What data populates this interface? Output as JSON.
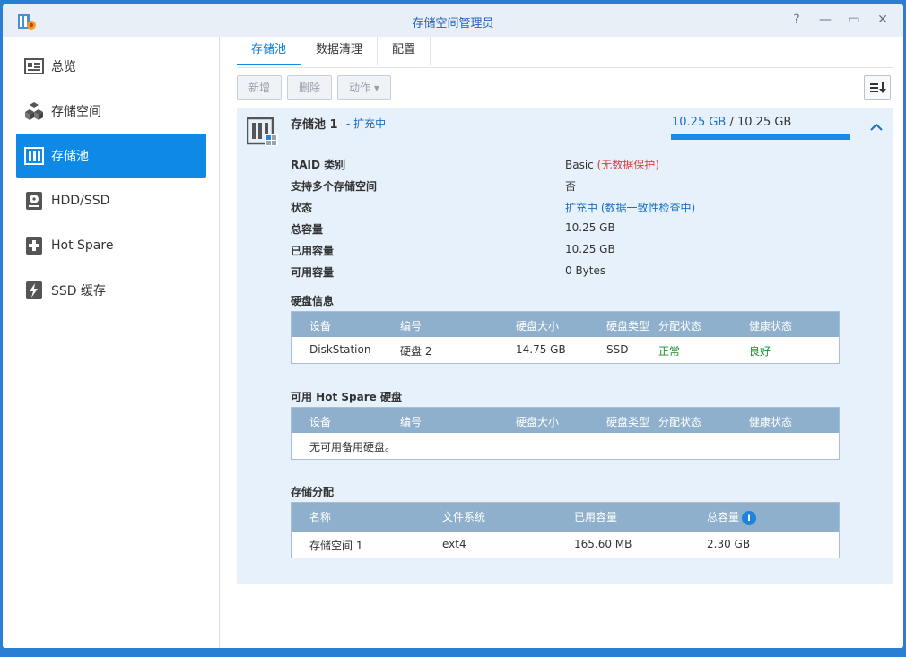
{
  "window": {
    "title": "存储空间管理员"
  },
  "sidebar": {
    "items": [
      {
        "label": "总览"
      },
      {
        "label": "存储空间"
      },
      {
        "label": "存储池"
      },
      {
        "label": "HDD/SSD"
      },
      {
        "label": "Hot Spare"
      },
      {
        "label": "SSD 缓存"
      }
    ]
  },
  "tabs": [
    {
      "label": "存储池"
    },
    {
      "label": "数据清理"
    },
    {
      "label": "配置"
    }
  ],
  "toolbar": {
    "add": "新增",
    "delete": "删除",
    "action": "动作 ▾"
  },
  "pool": {
    "name": "存储池 1",
    "status_suffix": "- 扩充中",
    "capacity_used": "10.25 GB",
    "capacity_sep": " / ",
    "capacity_total": "10.25 GB",
    "usage_percent": 100,
    "details": [
      {
        "label": "RAID 类别",
        "value": "Basic",
        "value_extra": " (无数据保护)"
      },
      {
        "label": "支持多个存储空间",
        "value": "否",
        "value_extra": ""
      },
      {
        "label": "状态",
        "value": "扩充中 (数据一致性检查中)",
        "value_extra": ""
      },
      {
        "label": "总容量",
        "value": "10.25 GB",
        "value_extra": ""
      },
      {
        "label": "已用容量",
        "value": "10.25 GB",
        "value_extra": ""
      },
      {
        "label": "可用容量",
        "value": "0 Bytes",
        "value_extra": ""
      }
    ],
    "disk_info": {
      "title": "硬盘信息",
      "columns": [
        "设备",
        "编号",
        "硬盘大小",
        "硬盘类型",
        "分配状态",
        "健康状态"
      ],
      "rows": [
        [
          "DiskStation",
          "硬盘 2",
          "14.75 GB",
          "SSD",
          "正常",
          "良好"
        ]
      ]
    },
    "hot_spare": {
      "title": "可用 Hot Spare 硬盘",
      "columns": [
        "设备",
        "编号",
        "硬盘大小",
        "硬盘类型",
        "分配状态",
        "健康状态"
      ],
      "empty_text": "无可用备用硬盘。"
    },
    "allocation": {
      "title": "存储分配",
      "columns": [
        "名称",
        "文件系统",
        "已用容量",
        "总容量"
      ],
      "rows": [
        [
          "存储空间 1",
          "ext4",
          "165.60 MB",
          "2.30 GB"
        ]
      ]
    }
  },
  "colors": {
    "accent": "#0e8ae6",
    "table_header": "#8fb0cc",
    "panel_bg": "#e6f1fb",
    "danger": "#e23b3b",
    "ok": "#1b8f2c"
  }
}
